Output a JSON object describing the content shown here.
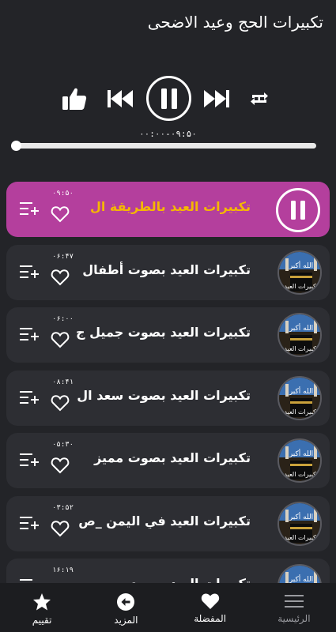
{
  "header": {
    "title": "تكبيرات الحج وعيد الاضحى"
  },
  "player": {
    "time_readout": "۰۰:۰۰-۰۹:۵۰",
    "progress": 0.0
  },
  "tracks": [
    {
      "title": "تكبيرات العيد بالطريقة ال",
      "duration": "۰۹:۵۰",
      "active": true
    },
    {
      "title": "تكبيرات العيد بصوت أطفال",
      "duration": "۰۶:۴۷",
      "active": false
    },
    {
      "title": "تكبيرات العيد بصوت جميل ج",
      "duration": "۰۶:۰۰",
      "active": false
    },
    {
      "title": "تكبيرات العيد بصوت سعد ال",
      "duration": "۰۸:۴۱",
      "active": false
    },
    {
      "title": "تكبيرات العيد بصوت مميز",
      "duration": "۰۵:۳۰",
      "active": false
    },
    {
      "title": "تكبيرات العيد في اليمن _ص",
      "duration": "۰۳:۵۲",
      "active": false
    },
    {
      "title": "تكبيرات العيد بصوت",
      "duration": "۱۶:۱۹",
      "active": false
    }
  ],
  "thumbnail_caption": "تكبيرات العيد",
  "nav": {
    "rate_label": "تقييم",
    "more_label": "المزيد",
    "favorites_label": "المفضلة",
    "home_label": "الرئيسية"
  },
  "colors": {
    "background": "#232428",
    "item_bg": "#2d2e33",
    "active_item_bg": "#b43f9d",
    "active_title": "#f5b800",
    "nav_bg": "#1c1d20"
  },
  "icons": [
    "thumbs-up-icon",
    "skip-previous-icon",
    "pause-icon",
    "skip-next-icon",
    "repeat-icon",
    "heart-icon",
    "add-to-playlist-icon",
    "star-icon",
    "arrow-left-circle-icon",
    "menu-icon"
  ]
}
